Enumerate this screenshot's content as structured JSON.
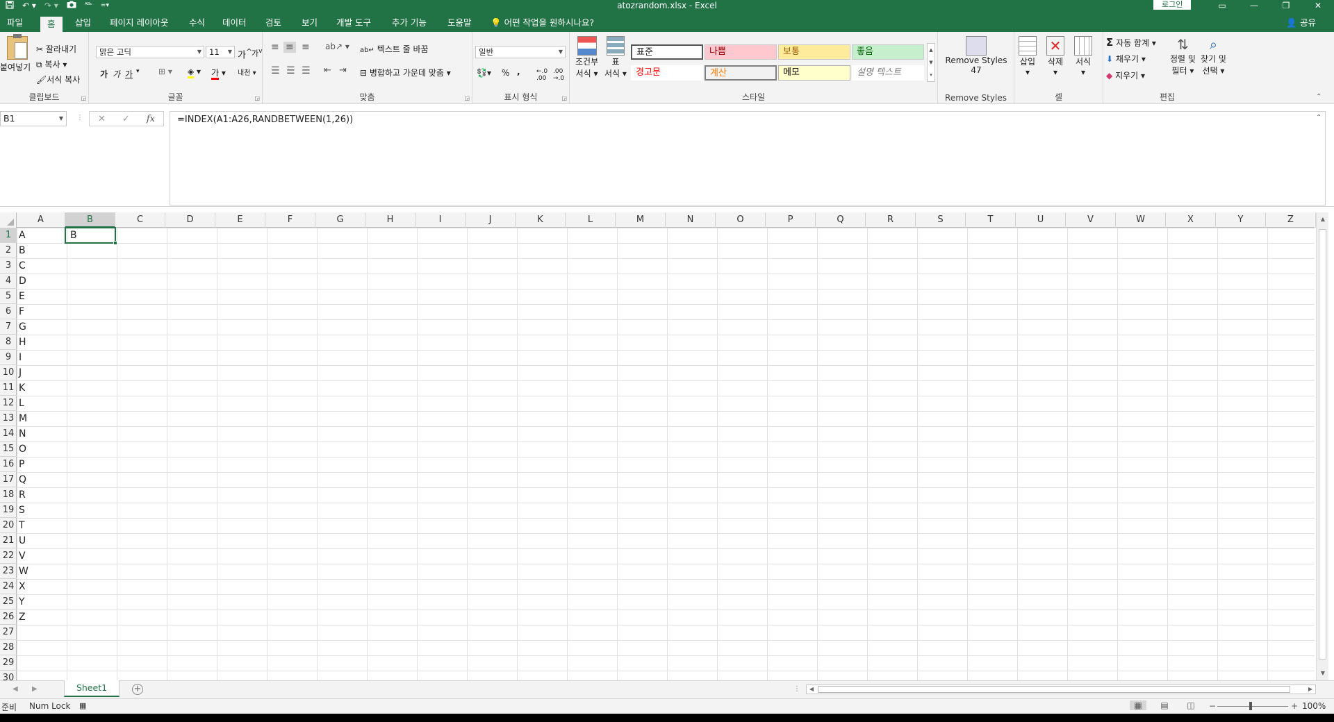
{
  "title_bar": {
    "title": "atozrandom.xlsx  -  Excel",
    "login_label": "로그인",
    "qat": [
      "save-icon",
      "undo-icon",
      "redo-icon",
      "camera-icon",
      "spelling-icon",
      "customize-icon"
    ]
  },
  "tabs": [
    {
      "label": "파일"
    },
    {
      "label": "홈"
    },
    {
      "label": "삽입"
    },
    {
      "label": "페이지 레이아웃"
    },
    {
      "label": "수식"
    },
    {
      "label": "데이터"
    },
    {
      "label": "검토"
    },
    {
      "label": "보기"
    },
    {
      "label": "개발 도구"
    },
    {
      "label": "추가 기능"
    },
    {
      "label": "도움말"
    }
  ],
  "tell_me": "어떤 작업을 원하시나요?",
  "share_label": "공유",
  "ribbon": {
    "clipboard": {
      "paste": "붙여넣기",
      "cut": "잘라내기",
      "copy": "복사",
      "format_painter": "서식 복사",
      "label": "클립보드"
    },
    "font": {
      "font_name": "맑은 고딕",
      "font_size": "11",
      "grow": "가",
      "shrink": "가",
      "bold": "가",
      "italic": "가",
      "underline": "가",
      "font_color_letter": "가",
      "phonetic": "내천",
      "label": "글꼴"
    },
    "alignment": {
      "wrap_text": "텍스트 줄 바꿈",
      "merge_center": "병합하고 가운데 맞춤",
      "label": "맞춤"
    },
    "number": {
      "format": "일반",
      "percent": "%",
      "comma": ",",
      "label": "표시 형식"
    },
    "styles": {
      "conditional": [
        "조건부",
        "서식"
      ],
      "table": [
        "표",
        "서식"
      ],
      "cells": [
        {
          "text": "표준",
          "bg": "#ffffff",
          "color": "#000000"
        },
        {
          "text": "나쁨",
          "bg": "#ffc7ce",
          "color": "#9c0006"
        },
        {
          "text": "보통",
          "bg": "#ffeb9c",
          "color": "#9c5700"
        },
        {
          "text": "좋음",
          "bg": "#c6efce",
          "color": "#006100"
        },
        {
          "text": "경고문",
          "bg": "#ffffff",
          "color": "#ff0000"
        },
        {
          "text": "계산",
          "bg": "#f2f2f2",
          "color": "#fa7d00"
        },
        {
          "text": "메모",
          "bg": "#ffffcc",
          "color": "#000000"
        },
        {
          "text": "설명 텍스트",
          "bg": "#ffffff",
          "color": "#7f7f7f"
        }
      ],
      "label": "스타일"
    },
    "remove_styles": {
      "button": "Remove Styles",
      "count": "47",
      "label": "Remove Styles"
    },
    "cells_group": {
      "insert": "삽입",
      "delete": "삭제",
      "format": "서식",
      "label": "셀"
    },
    "editing": {
      "autosum": "자동 합계",
      "fill": "채우기",
      "clear": "지우기",
      "sort_filter": [
        "정렬 및",
        "필터"
      ],
      "find_select": [
        "찾기 및",
        "선택"
      ],
      "label": "편집"
    }
  },
  "formula_bar": {
    "name_box": "B1",
    "cancel": "✕",
    "enter": "✓",
    "fx": "fx",
    "formula": "=INDEX(A1:A26,RANDBETWEEN(1,26))"
  },
  "columns": [
    "A",
    "B",
    "C",
    "D",
    "E",
    "F",
    "G",
    "H",
    "I",
    "J",
    "K",
    "L",
    "M",
    "N",
    "O",
    "P",
    "Q",
    "R",
    "S",
    "T",
    "U",
    "V",
    "W",
    "X",
    "Y",
    "Z"
  ],
  "rows": [
    "1",
    "2",
    "3",
    "4",
    "5",
    "6",
    "7",
    "8",
    "9",
    "10",
    "11",
    "12",
    "13",
    "14",
    "15",
    "16",
    "17",
    "18",
    "19",
    "20",
    "21",
    "22",
    "23",
    "24",
    "25",
    "26",
    "27",
    "28",
    "29",
    "30"
  ],
  "column_a_values": [
    "A",
    "B",
    "C",
    "D",
    "E",
    "F",
    "G",
    "H",
    "I",
    "J",
    "K",
    "L",
    "M",
    "N",
    "O",
    "P",
    "Q",
    "R",
    "S",
    "T",
    "U",
    "V",
    "W",
    "X",
    "Y",
    "Z"
  ],
  "b1_value": "B",
  "selected_cell": "B1",
  "sheet_tabs": [
    {
      "label": "Sheet1",
      "active": true
    }
  ],
  "status_bar": {
    "ready": "준비",
    "num_lock": "Num Lock",
    "zoom": "100%"
  },
  "colors": {
    "accent": "#217346"
  }
}
